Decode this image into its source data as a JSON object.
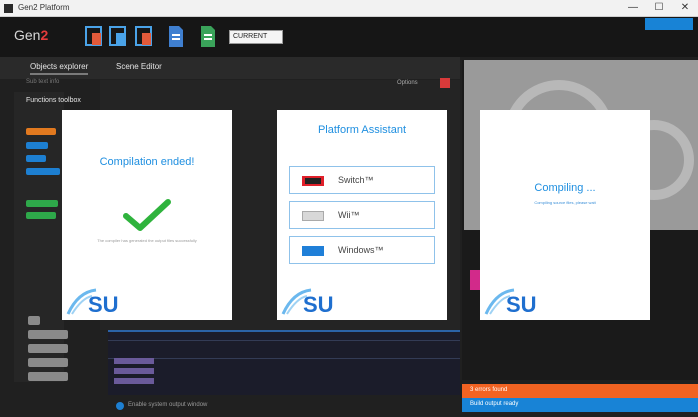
{
  "window": {
    "title": "Gen2 Platform",
    "controls": [
      "—",
      "☐",
      "✕"
    ]
  },
  "toolbar": {
    "logo_text": "Gen",
    "logo_accent": "2",
    "buttons": [
      {
        "icon": "compile-icon",
        "color": "#e35a3a"
      },
      {
        "icon": "compile-icon",
        "color": "#4aa3e8"
      },
      {
        "icon": "compile-icon",
        "color": "#e35a3a"
      },
      {
        "icon": "document-icon",
        "color": "#3f7fd0"
      },
      {
        "icon": "document-icon",
        "color": "#3aa35a"
      }
    ],
    "dropdown_value": "CURRENT"
  },
  "tabs": [
    {
      "label": "Objects explorer",
      "active": true
    },
    {
      "label": "Scene Editor",
      "active": false
    }
  ],
  "subline": "Sub text info",
  "functions_title": "Functions toolbox",
  "chips": [
    {
      "color": "#e1791f"
    },
    {
      "color": "#1d7fd1"
    },
    {
      "color": "#1d7fd1"
    },
    {
      "color": "#1d7fd1"
    },
    {
      "color": "#1d7fd1"
    },
    {
      "color": "#2ea84a"
    },
    {
      "color": "#2ea84a"
    }
  ],
  "side_buttons": [
    "",
    "",
    "",
    ""
  ],
  "footer": {
    "checkbox_text": "Enable system output window"
  },
  "dropdown_label": "Options",
  "cards": {
    "compilation": {
      "heading": "Compilation ended!",
      "message": "The compiler has generated the output files successfully"
    },
    "assistant": {
      "heading": "Platform Assistant",
      "options": [
        {
          "label": "Switch™",
          "icon": "switch-icon"
        },
        {
          "label": "Wii™",
          "icon": "wii-icon"
        },
        {
          "label": "Windows™",
          "icon": "windows-icon"
        }
      ]
    },
    "compiling": {
      "heading": "Compiling ...",
      "message": "Compiling source files, please wait"
    },
    "logo_text": "SU"
  },
  "status": {
    "orange_text": "3 errors found",
    "blue_text": "Build output ready",
    "orange": "#f26322",
    "blue": "#1883d6"
  }
}
